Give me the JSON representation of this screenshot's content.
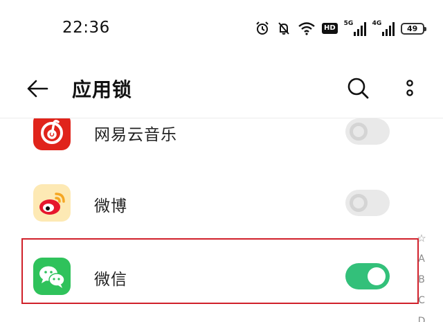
{
  "status_bar": {
    "time": "22:36",
    "hd_badge": "HD",
    "network1_label": "5G",
    "network2_label": "4G",
    "battery": "49"
  },
  "header": {
    "title": "应用锁"
  },
  "apps": [
    {
      "name": "网易云音乐",
      "locked": false,
      "icon": "netease-music-icon"
    },
    {
      "name": "微博",
      "locked": false,
      "icon": "weibo-icon"
    },
    {
      "name": "微信",
      "locked": true,
      "icon": "wechat-icon"
    }
  ],
  "index": {
    "star": "☆",
    "letters": [
      "A",
      "B",
      "C",
      "D"
    ]
  },
  "colors": {
    "toggle_on": "#33c07a",
    "toggle_off": "#e9e9e9",
    "highlight": "#d0202a",
    "netease": "#e0241b",
    "wechat": "#2fc25b"
  }
}
